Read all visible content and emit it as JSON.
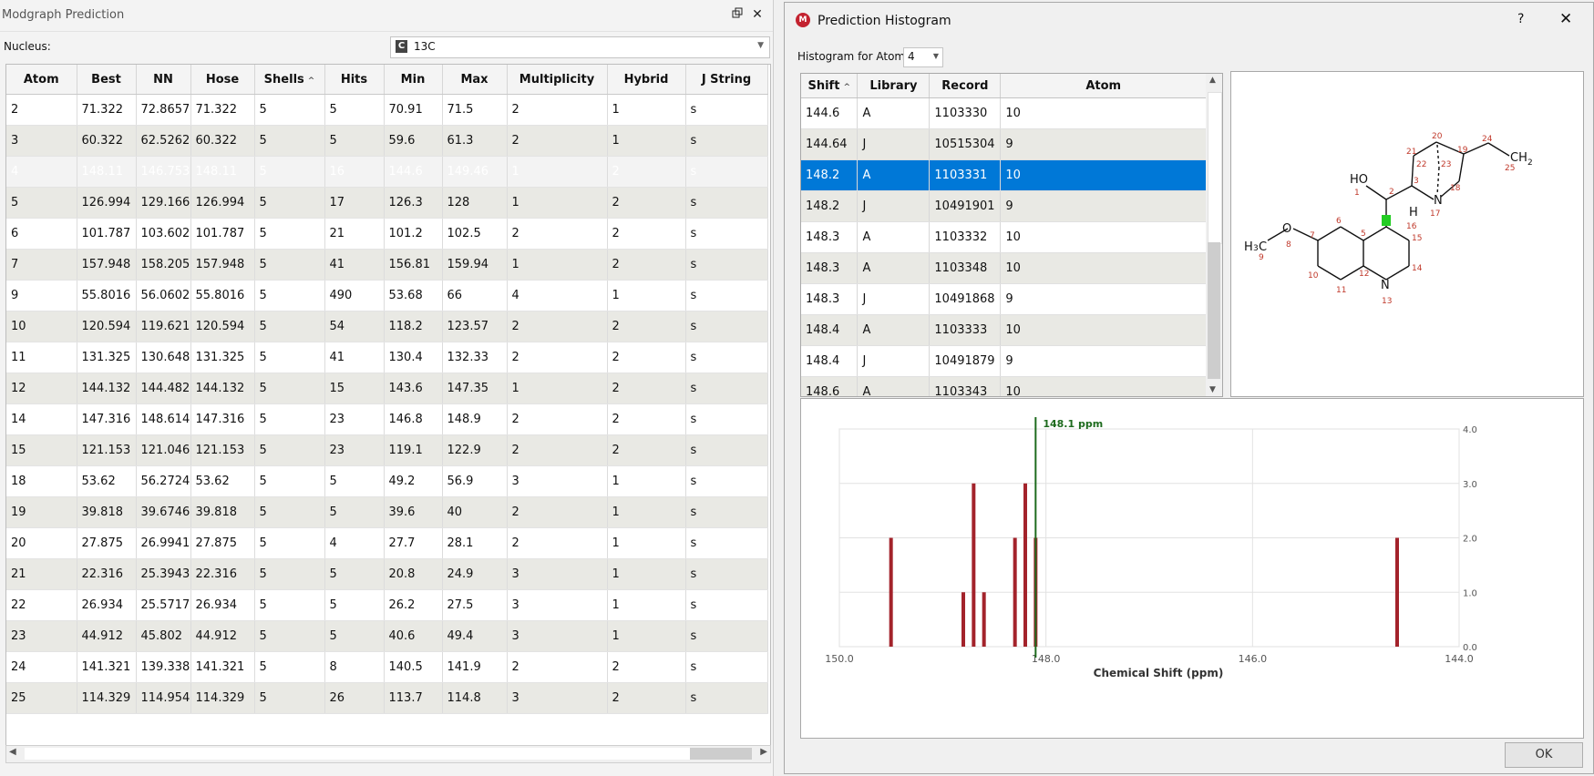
{
  "left_panel": {
    "title": "Modgraph Prediction",
    "restore_icon": "restore-icon",
    "close_label": "✕",
    "nucleus_label": "Nucleus:",
    "nucleus_value": "13C",
    "nucleus_icon_text": "C",
    "table": {
      "headers": [
        "Atom",
        "Best",
        "NN",
        "Hose",
        "Shells",
        "Hits",
        "Min",
        "Max",
        "Multiplicity",
        "Hybrid",
        "J String"
      ],
      "sort_column": "Shells",
      "rows": [
        [
          "2",
          "71.322",
          "72.8657",
          "71.322",
          "5",
          "5",
          "70.91",
          "71.5",
          "2",
          "1",
          "s"
        ],
        [
          "3",
          "60.322",
          "62.5262",
          "60.322",
          "5",
          "5",
          "59.6",
          "61.3",
          "2",
          "1",
          "s"
        ],
        [
          "4",
          "148.11",
          "146.753",
          "148.11",
          "5",
          "16",
          "144.6",
          "149.46",
          "1",
          "2",
          "s"
        ],
        [
          "5",
          "126.994",
          "129.166",
          "126.994",
          "5",
          "17",
          "126.3",
          "128",
          "1",
          "2",
          "s"
        ],
        [
          "6",
          "101.787",
          "103.602",
          "101.787",
          "5",
          "21",
          "101.2",
          "102.5",
          "2",
          "2",
          "s"
        ],
        [
          "7",
          "157.948",
          "158.205",
          "157.948",
          "5",
          "41",
          "156.81",
          "159.94",
          "1",
          "2",
          "s"
        ],
        [
          "9",
          "55.8016",
          "56.0602",
          "55.8016",
          "5",
          "490",
          "53.68",
          "66",
          "4",
          "1",
          "s"
        ],
        [
          "10",
          "120.594",
          "119.621",
          "120.594",
          "5",
          "54",
          "118.2",
          "123.57",
          "2",
          "2",
          "s"
        ],
        [
          "11",
          "131.325",
          "130.648",
          "131.325",
          "5",
          "41",
          "130.4",
          "132.33",
          "2",
          "2",
          "s"
        ],
        [
          "12",
          "144.132",
          "144.482",
          "144.132",
          "5",
          "15",
          "143.6",
          "147.35",
          "1",
          "2",
          "s"
        ],
        [
          "14",
          "147.316",
          "148.614",
          "147.316",
          "5",
          "23",
          "146.8",
          "148.9",
          "2",
          "2",
          "s"
        ],
        [
          "15",
          "121.153",
          "121.046",
          "121.153",
          "5",
          "23",
          "119.1",
          "122.9",
          "2",
          "2",
          "s"
        ],
        [
          "18",
          "53.62",
          "56.2724",
          "53.62",
          "5",
          "5",
          "49.2",
          "56.9",
          "3",
          "1",
          "s"
        ],
        [
          "19",
          "39.818",
          "39.6746",
          "39.818",
          "5",
          "5",
          "39.6",
          "40",
          "2",
          "1",
          "s"
        ],
        [
          "20",
          "27.875",
          "26.9941",
          "27.875",
          "5",
          "4",
          "27.7",
          "28.1",
          "2",
          "1",
          "s"
        ],
        [
          "21",
          "22.316",
          "25.3943",
          "22.316",
          "5",
          "5",
          "20.8",
          "24.9",
          "3",
          "1",
          "s"
        ],
        [
          "22",
          "26.934",
          "25.5717",
          "26.934",
          "5",
          "5",
          "26.2",
          "27.5",
          "3",
          "1",
          "s"
        ],
        [
          "23",
          "44.912",
          "45.802",
          "44.912",
          "5",
          "5",
          "40.6",
          "49.4",
          "3",
          "1",
          "s"
        ],
        [
          "24",
          "141.321",
          "139.338",
          "141.321",
          "5",
          "8",
          "140.5",
          "141.9",
          "2",
          "2",
          "s"
        ],
        [
          "25",
          "114.329",
          "114.954",
          "114.329",
          "5",
          "26",
          "113.7",
          "114.8",
          "3",
          "2",
          "s"
        ]
      ],
      "selected_row": 2
    }
  },
  "dialog": {
    "title": "Prediction Histogram",
    "help_label": "?",
    "close_label": "✕",
    "atom_label": "Histogram for Atom:",
    "atom_value": "4",
    "table": {
      "headers": [
        "Shift",
        "Library",
        "Record",
        "Atom"
      ],
      "sort_column": "Shift",
      "rows": [
        [
          "144.6",
          "A",
          "1103330",
          "10"
        ],
        [
          "144.64",
          "J",
          "10515304",
          "9"
        ],
        [
          "148.2",
          "A",
          "1103331",
          "10"
        ],
        [
          "148.2",
          "J",
          "10491901",
          "9"
        ],
        [
          "148.3",
          "A",
          "1103332",
          "10"
        ],
        [
          "148.3",
          "A",
          "1103348",
          "10"
        ],
        [
          "148.3",
          "J",
          "10491868",
          "9"
        ],
        [
          "148.4",
          "A",
          "1103333",
          "10"
        ],
        [
          "148.4",
          "J",
          "10491879",
          "9"
        ],
        [
          "148.6",
          "A",
          "1103343",
          "10"
        ]
      ],
      "selected_row": 2
    },
    "structure": {
      "atom_labels": [
        "1",
        "2",
        "3",
        "5",
        "6",
        "7",
        "8",
        "9",
        "10",
        "11",
        "12",
        "13",
        "14",
        "15",
        "16",
        "17",
        "18",
        "19",
        "20",
        "21",
        "22",
        "23",
        "24",
        "25"
      ],
      "group_labels": {
        "oh": "HO",
        "n17": "N",
        "n13": "N",
        "h16": "H",
        "ch3": "H3C",
        "ch2": "CH2",
        "o8": "O"
      },
      "highlight_color": "#22cc22",
      "label_color": "#c0392b"
    },
    "ok_label": "OK"
  },
  "chart_data": {
    "type": "bar",
    "xlabel": "Chemical Shift (ppm)",
    "ylabel": "",
    "xlim": [
      150.0,
      144.0
    ],
    "ylim": [
      0.0,
      4.0
    ],
    "x_ticks": [
      "150.0",
      "148.0",
      "146.0",
      "144.0"
    ],
    "y_ticks": [
      "0.0",
      "1.0",
      "2.0",
      "3.0",
      "4.0"
    ],
    "grid": true,
    "x": [
      149.5,
      148.8,
      148.7,
      148.6,
      148.3,
      148.2,
      148.1,
      144.6
    ],
    "values": [
      2,
      1,
      3,
      1,
      2,
      3,
      2,
      2
    ],
    "bar_color": "#a3232b",
    "marker": {
      "x": 148.1,
      "label": "148.1 ppm",
      "color": "#1e6b1e"
    }
  }
}
